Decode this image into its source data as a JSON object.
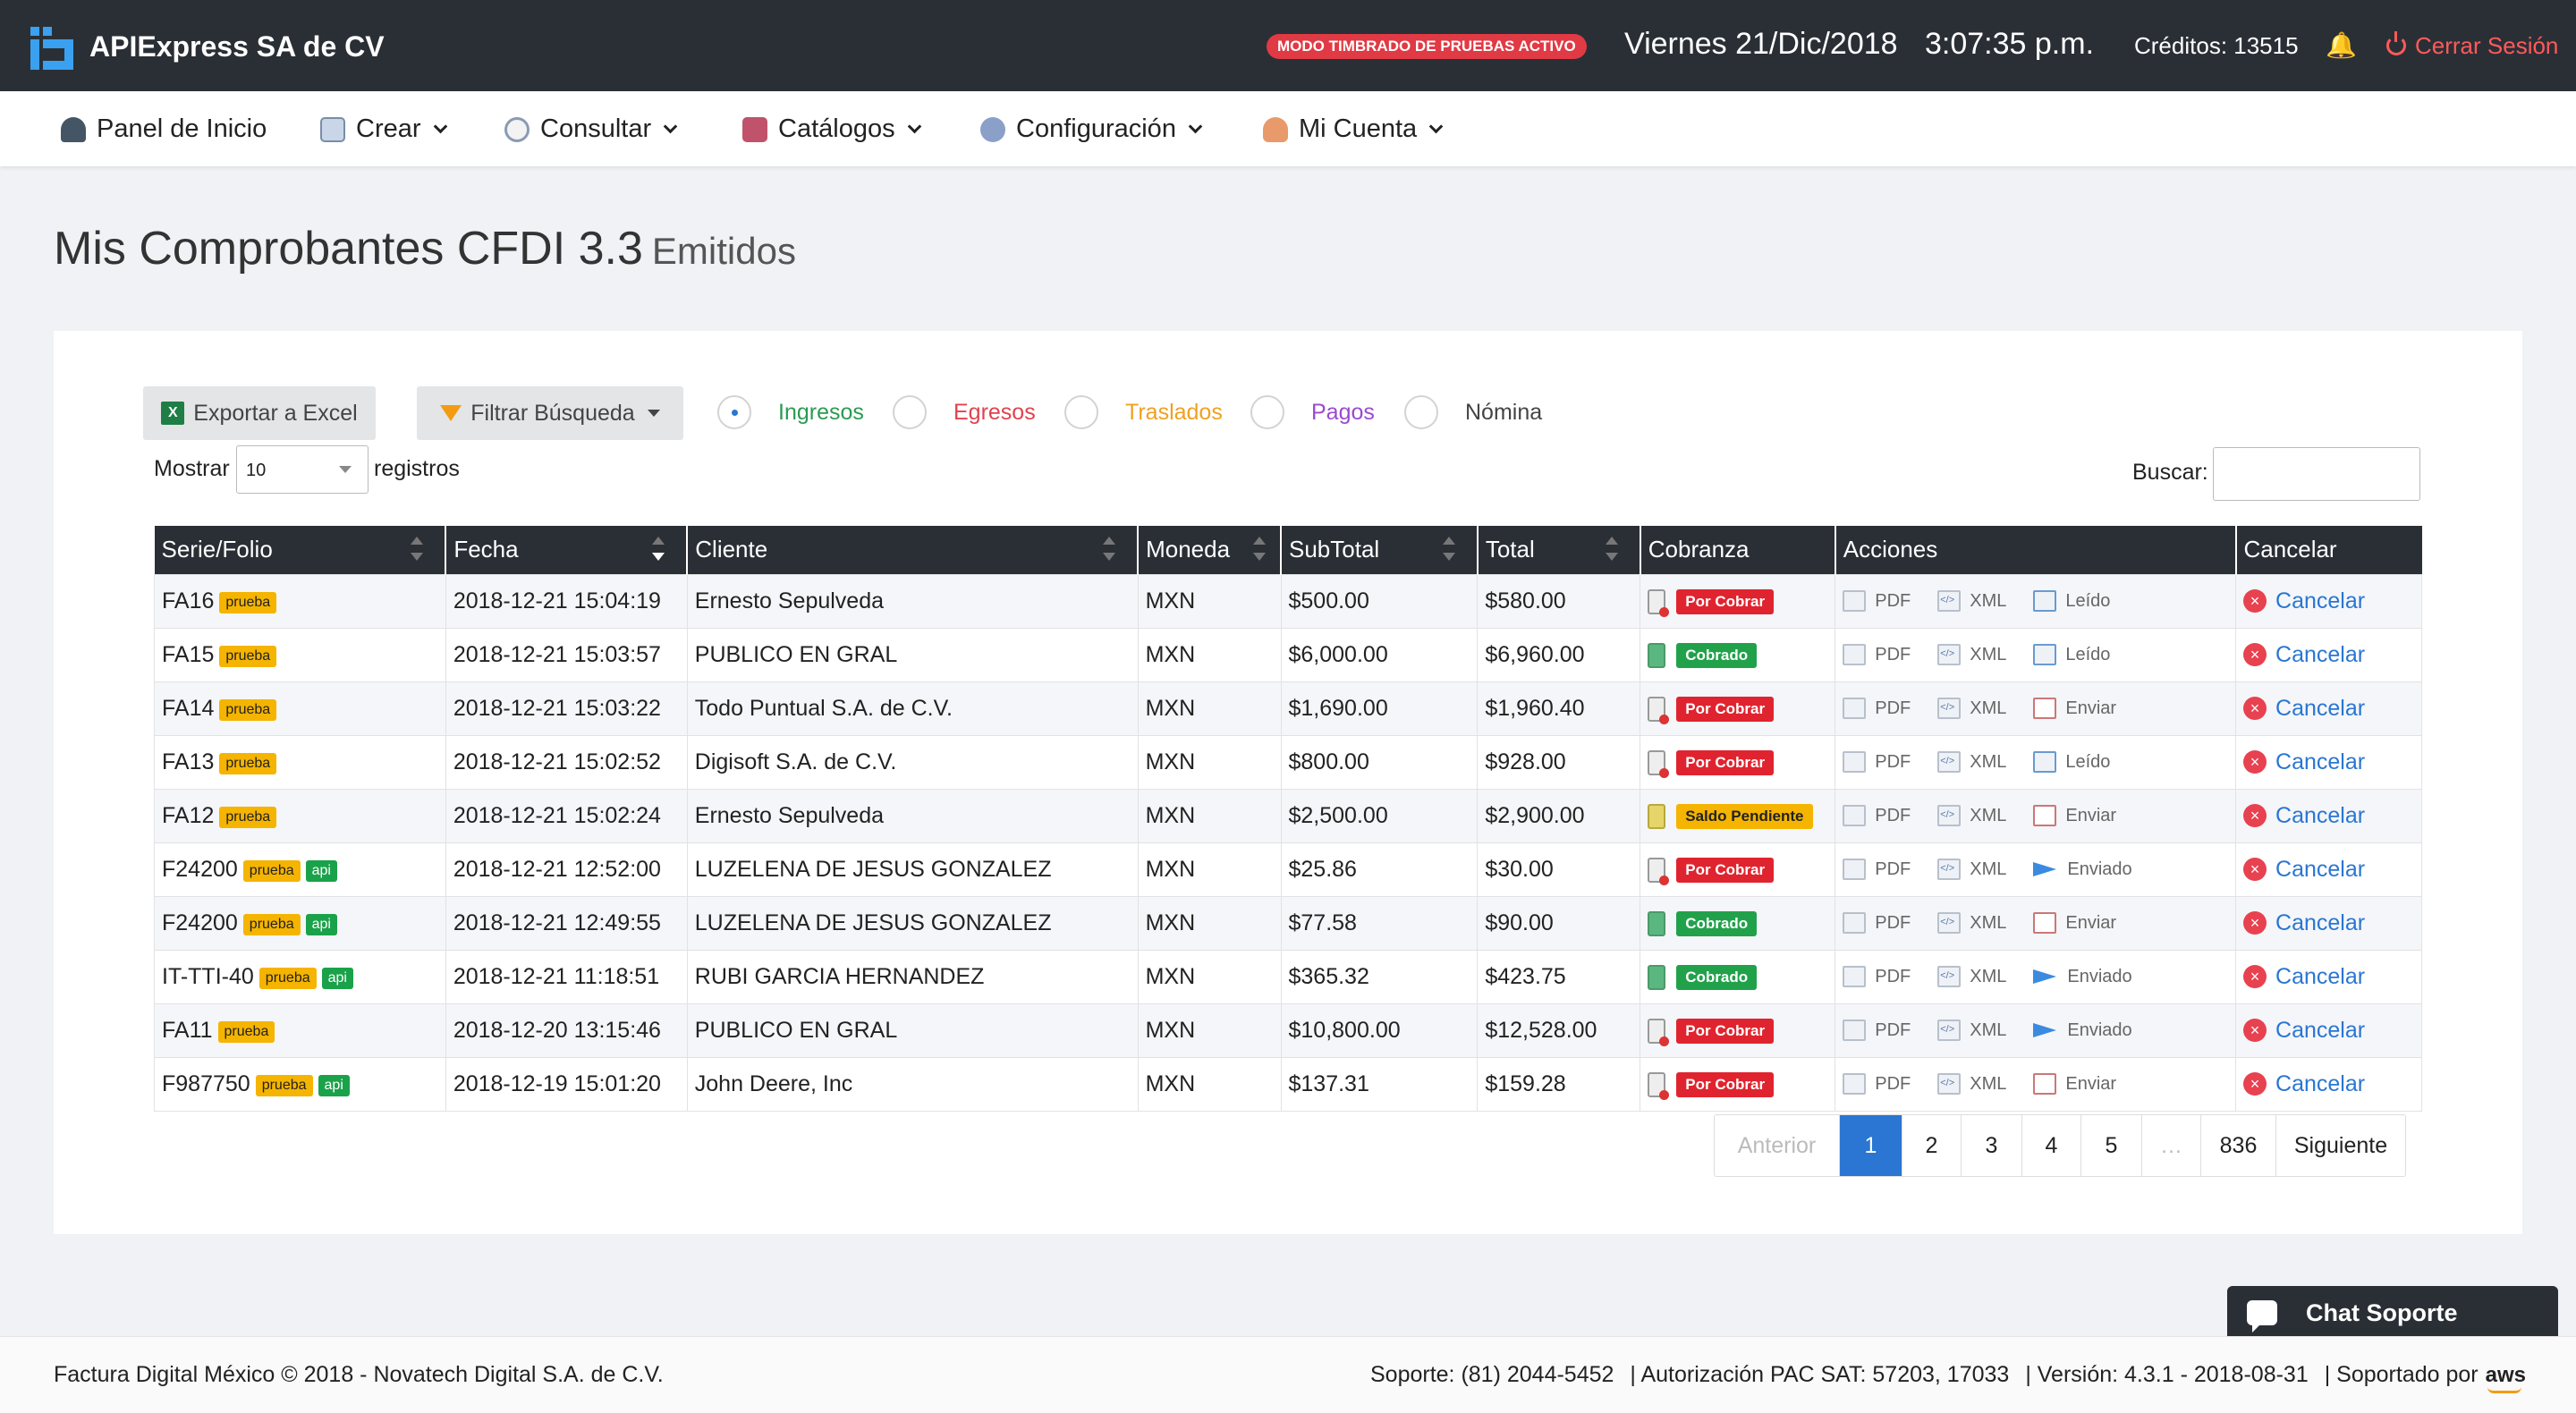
{
  "header": {
    "brand": "APIExpress SA de CV",
    "test_badge": "MODO TIMBRADO DE PRUEBAS ACTIVO",
    "date": "Viernes 21/Dic/2018",
    "time": "3:07:35 p.m.",
    "credits": "Créditos: 13515",
    "logout": "Cerrar Sesión",
    "accent": "#3aa0f0"
  },
  "nav": [
    {
      "label": "Panel de Inicio",
      "icon": "dashboard-icon",
      "dropdown": false
    },
    {
      "label": "Crear",
      "icon": "create-icon",
      "dropdown": true
    },
    {
      "label": "Consultar",
      "icon": "search-icon",
      "dropdown": true
    },
    {
      "label": "Catálogos",
      "icon": "catalog-icon",
      "dropdown": true
    },
    {
      "label": "Configuración",
      "icon": "gear-icon",
      "dropdown": true
    },
    {
      "label": "Mi Cuenta",
      "icon": "user-icon",
      "dropdown": true
    }
  ],
  "page": {
    "title": "Mis Comprobantes CFDI 3.3",
    "subtitle": "Emitidos"
  },
  "toolbar": {
    "export_label": "Exportar a Excel",
    "filter_label": "Filtrar Búsqueda",
    "types": [
      {
        "label": "Ingresos",
        "color": "#2a9a52",
        "selected": true
      },
      {
        "label": "Egresos",
        "color": "#e0424e",
        "selected": false
      },
      {
        "label": "Traslados",
        "color": "#f0a020",
        "selected": false
      },
      {
        "label": "Pagos",
        "color": "#9a4ad0",
        "selected": false
      },
      {
        "label": "Nómina",
        "color": "#444444",
        "selected": false
      }
    ],
    "show_label": "Mostrar",
    "show_value": "10",
    "records_label": "registros",
    "search_label": "Buscar:"
  },
  "table": {
    "columns": [
      "Serie/Folio",
      "Fecha",
      "Cliente",
      "Moneda",
      "SubTotal",
      "Total",
      "Cobranza",
      "Acciones",
      "Cancelar"
    ],
    "action_labels": {
      "pdf": "PDF",
      "xml": "XML"
    },
    "cancel_label": "Cancelar",
    "rows": [
      {
        "folio": "FA16",
        "tags": [
          "prueba"
        ],
        "fecha": "2018-12-21 15:04:19",
        "cliente": "Ernesto Sepulveda",
        "moneda": "MXN",
        "subtotal": "$500.00",
        "total": "$580.00",
        "cobranza": "Por Cobrar",
        "envio": "Leído"
      },
      {
        "folio": "FA15",
        "tags": [
          "prueba"
        ],
        "fecha": "2018-12-21 15:03:57",
        "cliente": "PUBLICO EN GRAL",
        "moneda": "MXN",
        "subtotal": "$6,000.00",
        "total": "$6,960.00",
        "cobranza": "Cobrado",
        "envio": "Leído"
      },
      {
        "folio": "FA14",
        "tags": [
          "prueba"
        ],
        "fecha": "2018-12-21 15:03:22",
        "cliente": "Todo Puntual S.A. de C.V.",
        "moneda": "MXN",
        "subtotal": "$1,690.00",
        "total": "$1,960.40",
        "cobranza": "Por Cobrar",
        "envio": "Enviar"
      },
      {
        "folio": "FA13",
        "tags": [
          "prueba"
        ],
        "fecha": "2018-12-21 15:02:52",
        "cliente": "Digisoft S.A. de C.V.",
        "moneda": "MXN",
        "subtotal": "$800.00",
        "total": "$928.00",
        "cobranza": "Por Cobrar",
        "envio": "Leído"
      },
      {
        "folio": "FA12",
        "tags": [
          "prueba"
        ],
        "fecha": "2018-12-21 15:02:24",
        "cliente": "Ernesto Sepulveda",
        "moneda": "MXN",
        "subtotal": "$2,500.00",
        "total": "$2,900.00",
        "cobranza": "Saldo Pendiente",
        "envio": "Enviar"
      },
      {
        "folio": "F24200",
        "tags": [
          "prueba",
          "api"
        ],
        "fecha": "2018-12-21 12:52:00",
        "cliente": "LUZELENA DE JESUS GONZALEZ",
        "moneda": "MXN",
        "subtotal": "$25.86",
        "total": "$30.00",
        "cobranza": "Por Cobrar",
        "envio": "Enviado"
      },
      {
        "folio": "F24200",
        "tags": [
          "prueba",
          "api"
        ],
        "fecha": "2018-12-21 12:49:55",
        "cliente": "LUZELENA DE JESUS GONZALEZ",
        "moneda": "MXN",
        "subtotal": "$77.58",
        "total": "$90.00",
        "cobranza": "Cobrado",
        "envio": "Enviar"
      },
      {
        "folio": "IT-TTI-40",
        "tags": [
          "prueba",
          "api"
        ],
        "fecha": "2018-12-21 11:18:51",
        "cliente": "RUBI GARCIA HERNANDEZ",
        "moneda": "MXN",
        "subtotal": "$365.32",
        "total": "$423.75",
        "cobranza": "Cobrado",
        "envio": "Enviado"
      },
      {
        "folio": "FA11",
        "tags": [
          "prueba"
        ],
        "fecha": "2018-12-20 13:15:46",
        "cliente": "PUBLICO EN GRAL",
        "moneda": "MXN",
        "subtotal": "$10,800.00",
        "total": "$12,528.00",
        "cobranza": "Por Cobrar",
        "envio": "Enviado"
      },
      {
        "folio": "F987750",
        "tags": [
          "prueba",
          "api"
        ],
        "fecha": "2018-12-19 15:01:20",
        "cliente": "John Deere, Inc",
        "moneda": "MXN",
        "subtotal": "$137.31",
        "total": "$159.28",
        "cobranza": "Por Cobrar",
        "envio": "Enviar"
      }
    ]
  },
  "pagination": {
    "prev": "Anterior",
    "pages": [
      "1",
      "2",
      "3",
      "4",
      "5",
      "…",
      "836"
    ],
    "active_page": "1",
    "next": "Siguiente"
  },
  "chat": {
    "label": "Chat Soporte"
  },
  "footer": {
    "copyright": "Factura Digital México © 2018 - Novatech Digital S.A. de C.V.",
    "support": "Soporte: (81) 2044-5452",
    "pac": "| Autorización PAC SAT: 57203, 17033",
    "version": "|  Versión: 4.3.1 - 2018-08-31",
    "hosted": "|  Soportado por",
    "aws": "aws"
  }
}
